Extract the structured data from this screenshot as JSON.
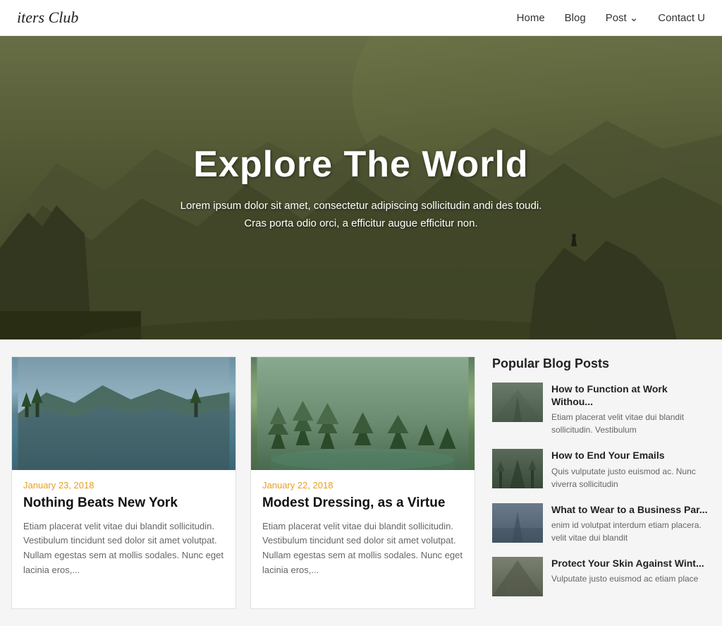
{
  "header": {
    "logo": "iters Club",
    "nav": [
      {
        "label": "Home",
        "id": "nav-home"
      },
      {
        "label": "Blog",
        "id": "nav-blog"
      },
      {
        "label": "Post",
        "id": "nav-post",
        "hasDropdown": true
      },
      {
        "label": "Contact U",
        "id": "nav-contact"
      }
    ]
  },
  "hero": {
    "title": "Explore The World",
    "subtitle_line1": "Lorem ipsum dolor sit amet, consectetur adipiscing sollicitudin andi des toudi.",
    "subtitle_line2": "Cras porta odio orci, a efficitur augue efficitur non."
  },
  "blog_posts": [
    {
      "id": "post-1",
      "date": "January 23, 2018",
      "title": "Nothing Beats New York",
      "excerpt": "Etiam placerat velit vitae dui blandit sollicitudin. Vestibulum tincidunt sed dolor sit amet volutpat. Nullam egestas sem at mollis sodales. Nunc eget lacinia eros,..."
    },
    {
      "id": "post-2",
      "date": "January 22, 2018",
      "title": "Modest Dressing, as a Virtue",
      "excerpt": "Etiam placerat velit vitae dui blandit sollicitudin. Vestibulum tincidunt sed dolor sit amet volutpat. Nullam egestas sem at mollis sodales. Nunc eget lacinia eros,..."
    }
  ],
  "sidebar": {
    "title": "Popular Blog Posts",
    "posts": [
      {
        "id": "popular-1",
        "title": "How to Function at Work Withou...",
        "excerpt": "Etiam placerat velit vitae dui blandit sollicitudin. Vestibulum",
        "thumb_type": "road"
      },
      {
        "id": "popular-2",
        "title": "How to End Your Emails",
        "excerpt": "Quis vulputate justo euismod ac. Nunc viverra sollicitudin",
        "thumb_type": "forest"
      },
      {
        "id": "popular-3",
        "title": "What to Wear to a Business Par...",
        "excerpt": "enim id volutpat interdum etiam placera. velit vitae dui blandit",
        "thumb_type": "party"
      },
      {
        "id": "popular-4",
        "title": "Protect Your Skin Against Wint...",
        "excerpt": "Vulputate justo euismod ac etiam place",
        "thumb_type": "skin"
      }
    ]
  }
}
